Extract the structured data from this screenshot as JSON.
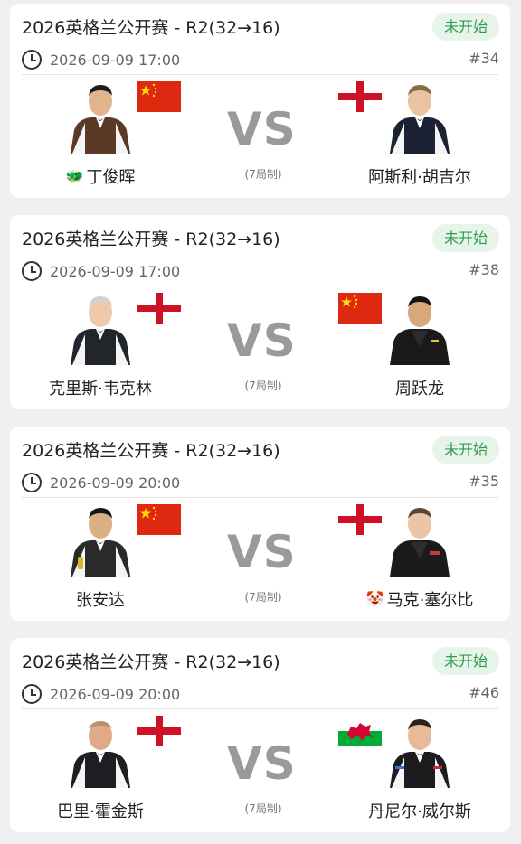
{
  "matches": [
    {
      "title": "2026英格兰公开赛 - R2(32→16)",
      "status": "未开始",
      "time": "2026-09-09 17:00",
      "match_no": "#34",
      "vs": "VS",
      "format": "(7局制)",
      "left": {
        "name": "丁俊晖",
        "emoji": "🐲",
        "flag": "china"
      },
      "right": {
        "name": "阿斯利·胡吉尔",
        "emoji": "",
        "flag": "england"
      }
    },
    {
      "title": "2026英格兰公开赛 - R2(32→16)",
      "status": "未开始",
      "time": "2026-09-09 17:00",
      "match_no": "#38",
      "vs": "VS",
      "format": "(7局制)",
      "left": {
        "name": "克里斯·韦克林",
        "emoji": "",
        "flag": "england"
      },
      "right": {
        "name": "周跃龙",
        "emoji": "",
        "flag": "china"
      }
    },
    {
      "title": "2026英格兰公开赛 - R2(32→16)",
      "status": "未开始",
      "time": "2026-09-09 20:00",
      "match_no": "#35",
      "vs": "VS",
      "format": "(7局制)",
      "left": {
        "name": "张安达",
        "emoji": "",
        "flag": "china"
      },
      "right": {
        "name": "马克·塞尔比",
        "emoji": "🤡",
        "flag": "england"
      }
    },
    {
      "title": "2026英格兰公开赛 - R2(32→16)",
      "status": "未开始",
      "time": "2026-09-09 20:00",
      "match_no": "#46",
      "vs": "VS",
      "format": "(7局制)",
      "left": {
        "name": "巴里·霍金斯",
        "emoji": "",
        "flag": "england"
      },
      "right": {
        "name": "丹尼尔·威尔斯",
        "emoji": "",
        "flag": "wales"
      }
    }
  ],
  "colors": {
    "status_text": "#2f9a4c",
    "status_bg": "#e6f4e9",
    "vs": "#9a9a9a",
    "china_red": "#de2910",
    "china_star": "#ffde00",
    "england_red": "#ce1124",
    "wales_green": "#00ab39"
  }
}
